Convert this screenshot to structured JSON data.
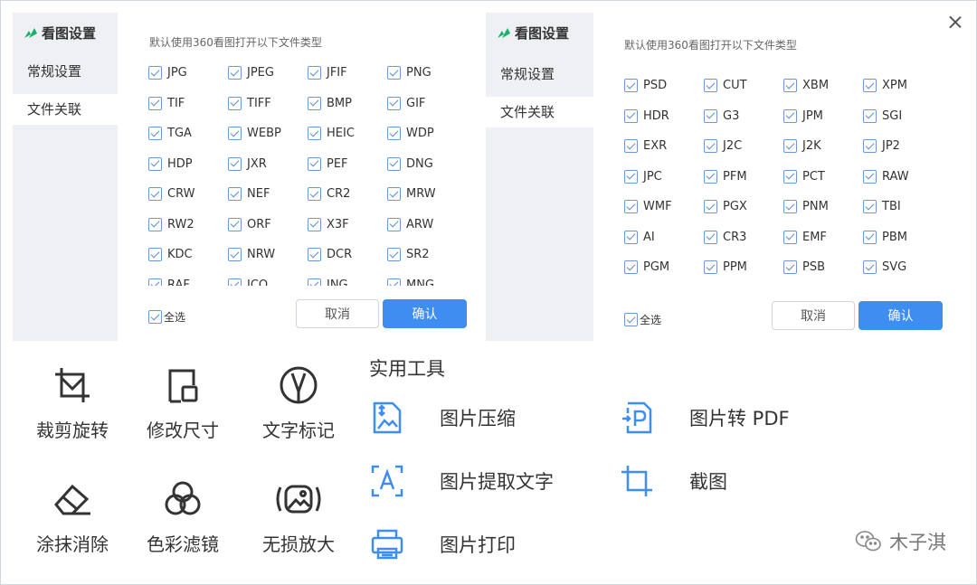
{
  "dialog": {
    "title": "看图设置",
    "nav": [
      "常规设置",
      "文件关联"
    ],
    "heading": "默认使用360看图打开以下文件类型",
    "select_all": "全选",
    "cancel": "取消",
    "confirm": "确认"
  },
  "left_types": [
    "JPG",
    "JPEG",
    "JFIF",
    "PNG",
    "TIF",
    "TIFF",
    "BMP",
    "GIF",
    "TGA",
    "WEBP",
    "HEIC",
    "WDP",
    "HDP",
    "JXR",
    "PEF",
    "DNG",
    "CRW",
    "NEF",
    "CR2",
    "MRW",
    "RW2",
    "ORF",
    "X3F",
    "ARW",
    "KDC",
    "NRW",
    "DCR",
    "SR2",
    "RAF",
    "ICO",
    "JNG",
    "MNG"
  ],
  "right_types": [
    "PSD",
    "CUT",
    "XBM",
    "XPM",
    "HDR",
    "G3",
    "JPM",
    "SGI",
    "EXR",
    "J2C",
    "J2K",
    "JP2",
    "JPC",
    "PFM",
    "PCT",
    "RAW",
    "WMF",
    "PGX",
    "PNM",
    "TBI",
    "AI",
    "CR3",
    "EMF",
    "PBM",
    "PGM",
    "PPM",
    "PSB",
    "SVG"
  ],
  "tools": [
    {
      "label": "裁剪旋转",
      "icon": "crop-icon"
    },
    {
      "label": "修改尺寸",
      "icon": "resize-icon"
    },
    {
      "label": "文字标记",
      "icon": "pen-mark-icon"
    },
    {
      "label": "涂抹消除",
      "icon": "eraser-icon"
    },
    {
      "label": "色彩滤镜",
      "icon": "color-filter-icon"
    },
    {
      "label": "无损放大",
      "icon": "upscale-icon"
    }
  ],
  "utilities": {
    "title": "实用工具",
    "items": [
      {
        "label": "图片压缩",
        "icon": "image-compress-icon"
      },
      {
        "label": "图片转 PDF",
        "icon": "image-to-pdf-icon"
      },
      {
        "label": "图片提取文字",
        "icon": "ocr-text-icon"
      },
      {
        "label": "截图",
        "icon": "screenshot-icon"
      },
      {
        "label": "图片打印",
        "icon": "print-icon"
      }
    ]
  },
  "watermark": "木子淇",
  "colors": {
    "accent": "#3e8df0",
    "checkbox": "#5b8bd0",
    "sidebar": "#eef0f3",
    "icon_blue": "#3e8df0"
  }
}
